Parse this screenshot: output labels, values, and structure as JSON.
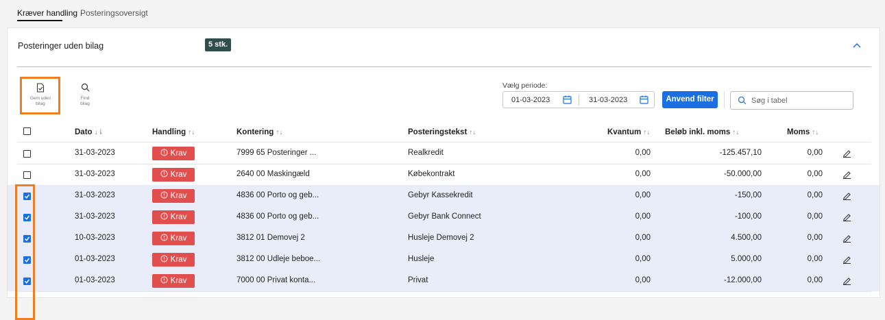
{
  "tabs": [
    {
      "label": "Kræver handling",
      "active": true
    },
    {
      "label": "Posteringsoversigt",
      "active": false
    }
  ],
  "card": {
    "title": "Posteringer uden bilag",
    "count": "5 stk."
  },
  "tools": [
    {
      "label1": "Gem uden",
      "label2": "bilag",
      "icon": "file-check-icon"
    },
    {
      "label1": "Find",
      "label2": "bilag",
      "icon": "search-icon"
    }
  ],
  "filter": {
    "period_label": "Vælg periode:",
    "from": "01-03-2023",
    "to": "31-03-2023",
    "apply_label": "Anvend filter",
    "search_placeholder": "Søg i tabel"
  },
  "table": {
    "headers": [
      "Dato",
      "Handling",
      "Kontering",
      "Posteringstekst",
      "Kvantum",
      "Beløb inkl. moms",
      "Moms"
    ],
    "rows": [
      {
        "checked": false,
        "date": "31-03-2023",
        "action": "Krav",
        "kontering": "7999 65 Posteringer ...",
        "text": "Realkredit",
        "kvantum": "0,00",
        "amount": "-125.457,10",
        "moms": "0,00"
      },
      {
        "checked": false,
        "date": "31-03-2023",
        "action": "Krav",
        "kontering": "2640 00 Maskingæld",
        "text": "Købekontrakt",
        "kvantum": "0,00",
        "amount": "-50.000,00",
        "moms": "0,00"
      },
      {
        "checked": true,
        "date": "31-03-2023",
        "action": "Krav",
        "kontering": "4836 00 Porto og geb...",
        "text": "Gebyr Kassekredit",
        "kvantum": "0,00",
        "amount": "-150,00",
        "moms": "0,00"
      },
      {
        "checked": true,
        "date": "31-03-2023",
        "action": "Krav",
        "kontering": "4836 00 Porto og geb...",
        "text": "Gebyr Bank Connect",
        "kvantum": "0,00",
        "amount": "-100,00",
        "moms": "0,00"
      },
      {
        "checked": true,
        "date": "10-03-2023",
        "action": "Krav",
        "kontering": "3812 01 Demovej 2",
        "text": "Husleje Demovej 2",
        "kvantum": "0,00",
        "amount": "4.500,00",
        "moms": "0,00"
      },
      {
        "checked": true,
        "date": "01-03-2023",
        "action": "Krav",
        "kontering": "3812 00 Udleje beboe...",
        "text": "Husleje",
        "kvantum": "0,00",
        "amount": "5.000,00",
        "moms": "0,00"
      },
      {
        "checked": true,
        "date": "01-03-2023",
        "action": "Krav",
        "kontering": "7000 00 Privat konta...",
        "text": "Privat",
        "kvantum": "0,00",
        "amount": "-12.000,00",
        "moms": "0,00"
      }
    ]
  },
  "colors": {
    "accent": "#1b6fe0",
    "badge": "#e04e4e",
    "highlight": "#f07d1f",
    "selected_row": "#e8edf9"
  }
}
